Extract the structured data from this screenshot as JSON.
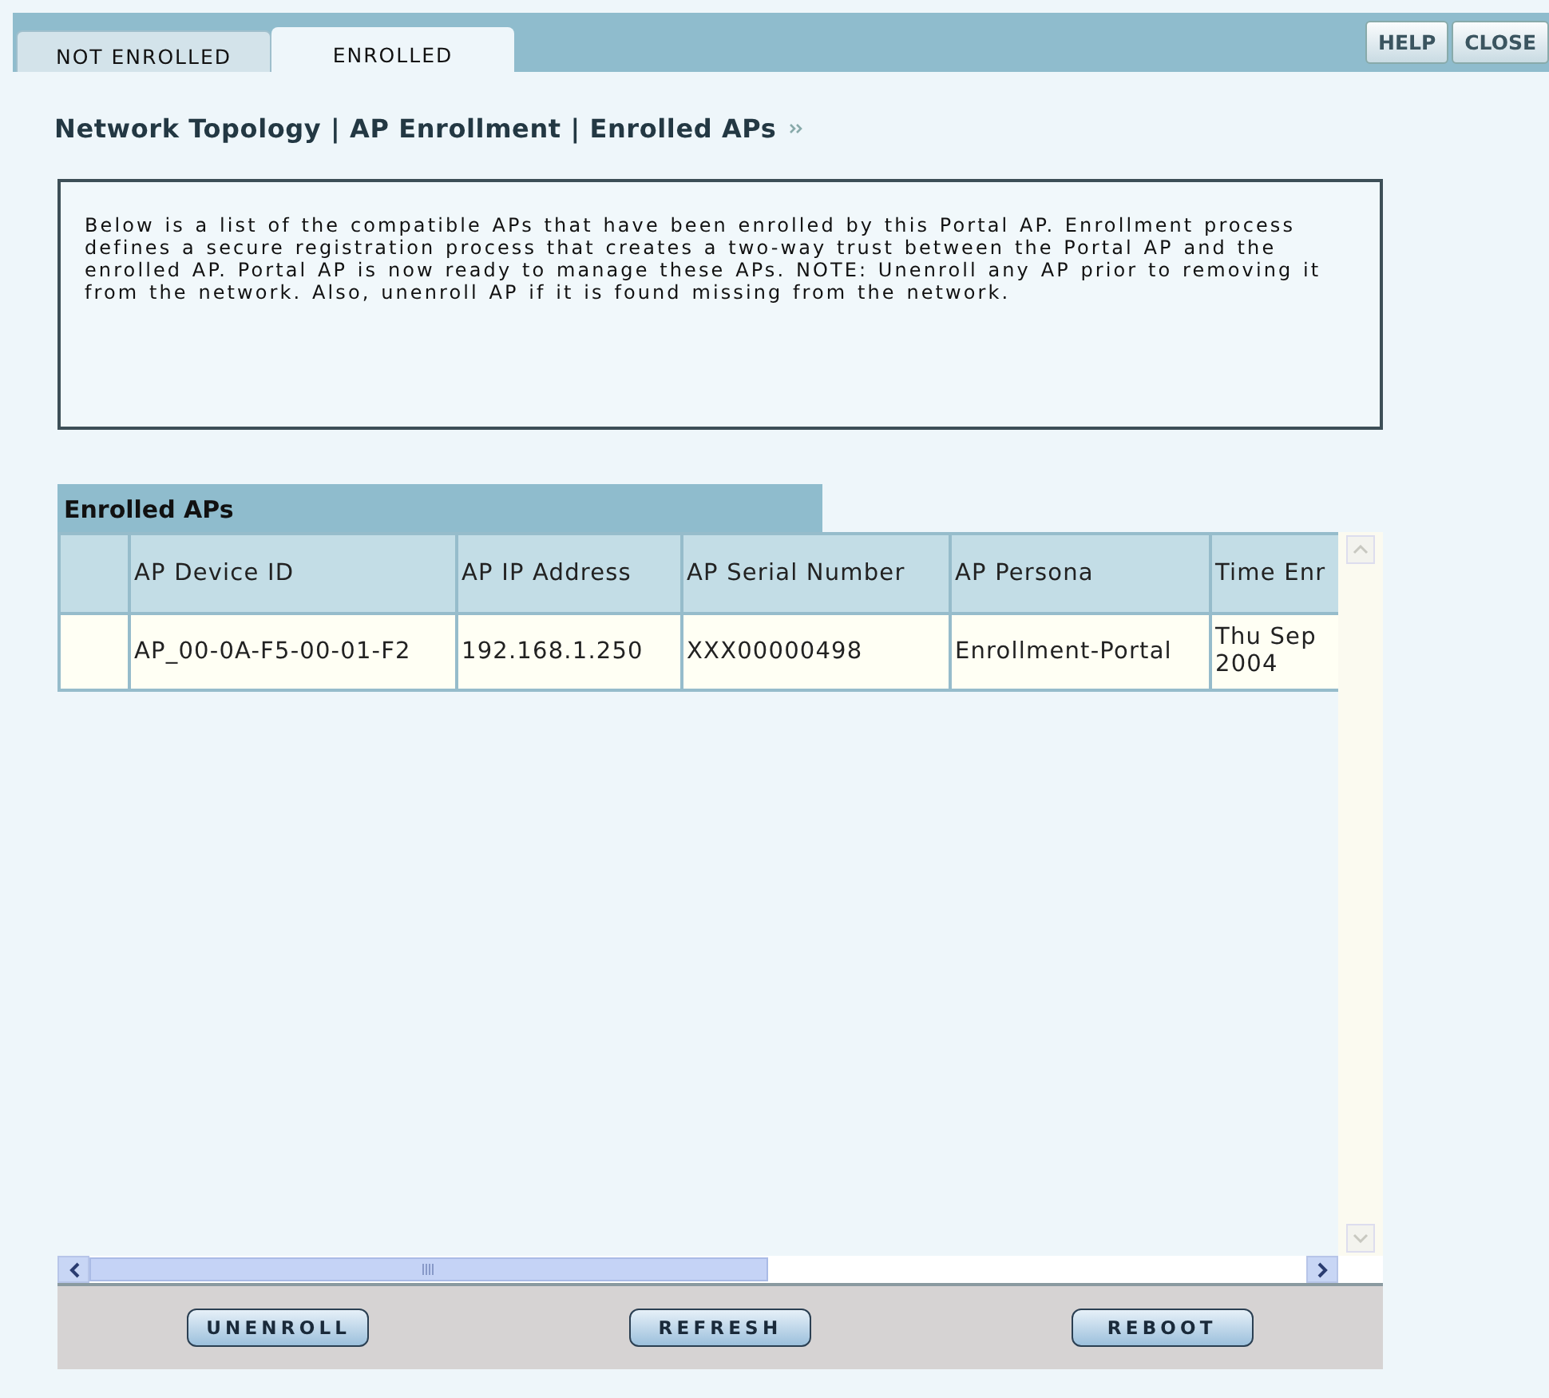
{
  "tabs": [
    {
      "label": "NOT ENROLLED",
      "selected": false
    },
    {
      "label": "ENROLLED",
      "selected": true
    }
  ],
  "header_buttons": [
    "HELP",
    "CLOSE"
  ],
  "breadcrumb": "Network Topology | AP Enrollment | Enrolled APs",
  "description": "Below is a list of the compatible APs that have been enrolled by this Portal AP. Enrollment process defines a secure registration process that creates a two-way trust between the Portal AP and the enrolled AP. Portal AP is now ready to manage these APs. NOTE: Unenroll any AP prior to removing it from the network. Also, unenroll AP if it is found missing from the network.",
  "table": {
    "title": "Enrolled APs",
    "columns": [
      "AP Device ID",
      "AP IP Address",
      "AP Serial Number",
      "AP Persona",
      "Time Enr"
    ],
    "rows": [
      [
        "AP_00-0A-F5-00-01-F2",
        "192.168.1.250",
        "XXX00000498",
        "Enrollment-Portal",
        "Thu Sep 2004"
      ]
    ]
  },
  "actions": [
    "UNENROLL",
    "REFRESH",
    "REBOOT"
  ]
}
